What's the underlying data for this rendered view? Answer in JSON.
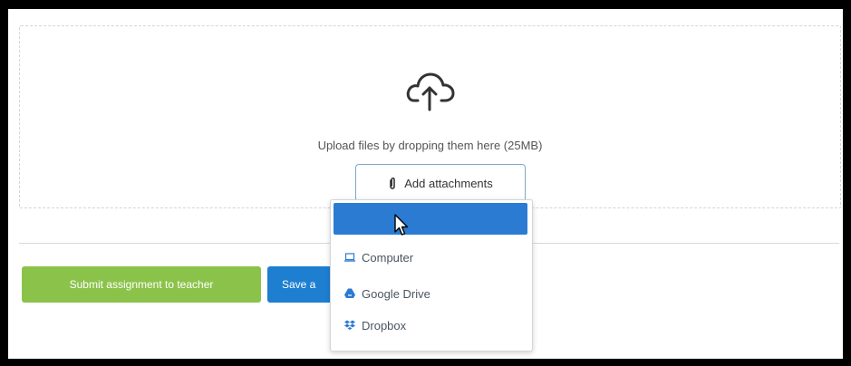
{
  "upload": {
    "message": "Upload files by dropping them here (25MB)",
    "attach_button_label": "Add attachments"
  },
  "actions": {
    "submit_label": "Submit assignment to teacher",
    "save_label": "Save a"
  },
  "attach_menu": {
    "items": [
      {
        "label": "Computer",
        "icon": "laptop-icon"
      },
      {
        "label": "Google Drive",
        "icon": "google-drive-icon"
      },
      {
        "label": "Dropbox",
        "icon": "dropbox-icon"
      }
    ]
  },
  "colors": {
    "submit_green": "#8bc34a",
    "save_blue": "#1e7fd1",
    "menu_highlight": "#2b7bd2"
  }
}
